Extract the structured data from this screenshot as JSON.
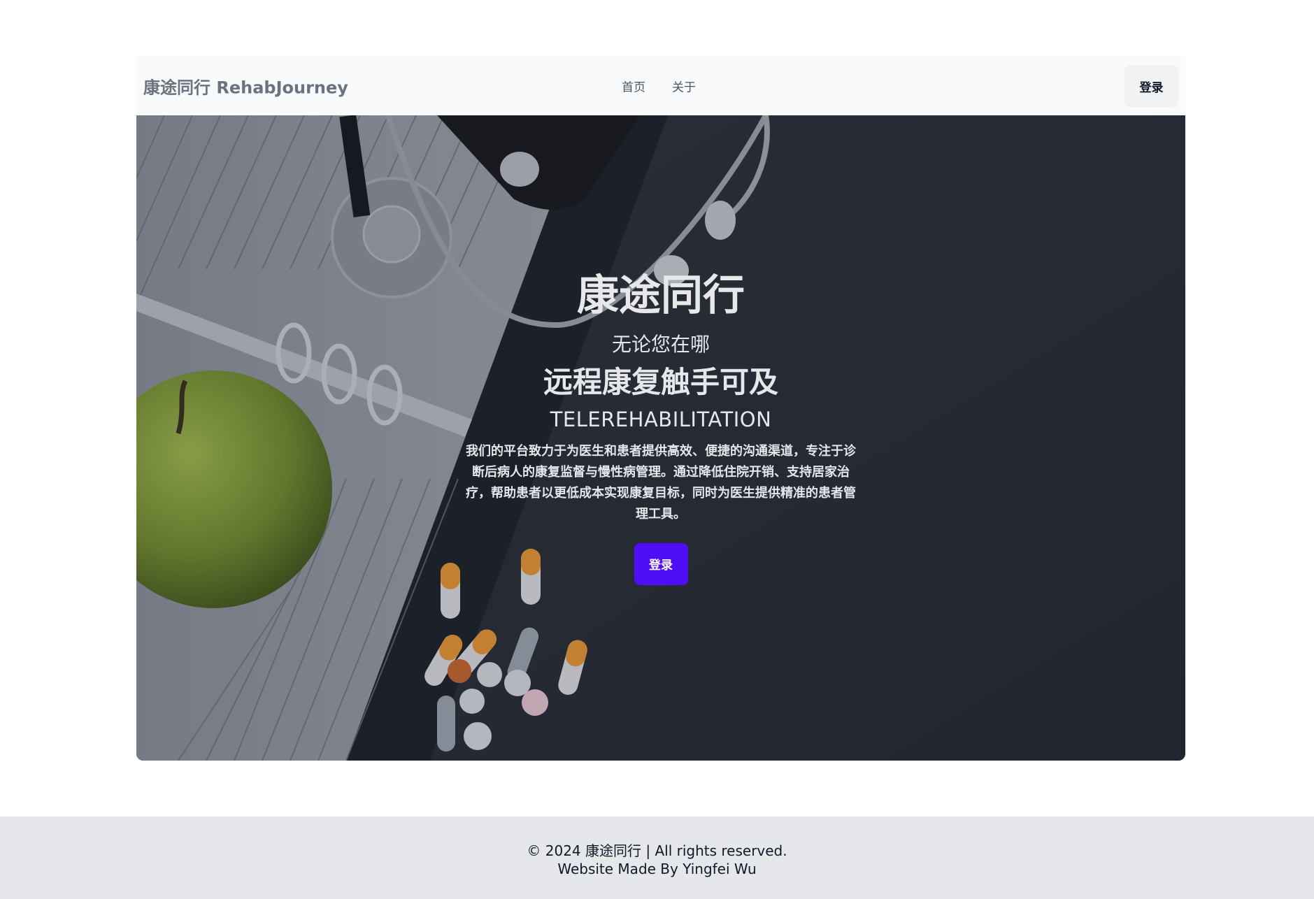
{
  "navbar": {
    "brand": "康途同行 RehabJourney",
    "links": [
      "首页",
      "关于"
    ],
    "login_label": "登录"
  },
  "hero": {
    "title": "康途同行",
    "subtitle_1": "无论您在哪",
    "subtitle_2": "远程康复触手可及",
    "subtitle_3": "TELEREHABILITATION",
    "description": "我们的平台致力于为医生和患者提供高效、便捷的沟通渠道，专注于诊断后病人的康复监督与慢性病管理。通过降低住院开销、支持居家治疗，帮助患者以更低成本实现康复目标，同时为医生提供精准的患者管理工具。",
    "login_label": "登录",
    "background_image": "stethoscope-apple-notebook-pills-photo",
    "accent_color": "#4f0ef7"
  },
  "footer": {
    "line1": "© 2024 康途同行 | All rights reserved.",
    "line2": "Website Made By Yingfei Wu"
  }
}
